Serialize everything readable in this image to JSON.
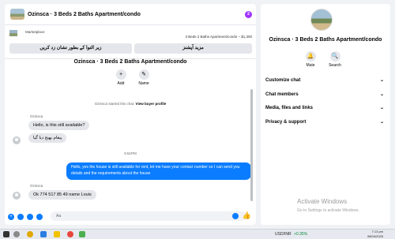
{
  "chat_header": {
    "title": "Ozinsca · 3 Beds 2 Baths Apartment/condo",
    "badge": "2"
  },
  "marketplace": {
    "label": "Marketplace",
    "listing": "3 Beds 2 Baths Apartment/condo – $1,300",
    "buttons": [
      "زیر التوا کے بطور نشان زد کریں",
      "مزید آپشنز"
    ]
  },
  "thread": {
    "title": "Ozinsca · 3 Beds 2 Baths Apartment/condo",
    "actions": [
      {
        "icon": "+",
        "label": "Add"
      },
      {
        "icon": "✎",
        "label": "Name"
      }
    ],
    "started_text": "Ozinsca started this chat.",
    "started_link": "View buyer profile",
    "messages": [
      {
        "sender": "Ozinsca",
        "text": "Hello, is this still available?"
      },
      {
        "text": "پیغام بھیج دیا گیا"
      },
      {
        "time": "6:51PM"
      },
      {
        "text": "Hello, yes the house is still available for rent, let me have your contact number so I can send you details and the requirements about the house"
      },
      {
        "sender": "Ozinsca",
        "text": "Ok 774 517 85 49 name Louis"
      }
    ]
  },
  "composer": {
    "placeholder": "Aa"
  },
  "info": {
    "name": "Ozinsca · 3 Beds 2 Baths Apartment/condo",
    "actions": [
      {
        "icon": "🔔",
        "label": "Mute"
      },
      {
        "icon": "🔍",
        "label": "Search"
      }
    ],
    "rows": [
      "Customize chat",
      "Chat members",
      "Media, files and links",
      "Privacy & support"
    ],
    "watermark_title": "Activate Windows",
    "watermark_sub": "Go to Settings to activate Windows."
  },
  "taskbar": {
    "ticker": "USD/INR",
    "change": "+0.35%",
    "time": "7:13 pm",
    "date": "08/04/2025"
  },
  "colors": {
    "accent": "#0a7cff",
    "badge": "#a033ff"
  }
}
